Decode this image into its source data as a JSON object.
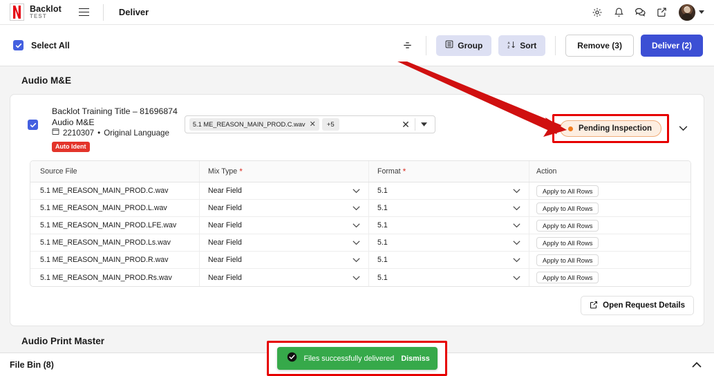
{
  "topbar": {
    "brand_name": "Backlot",
    "brand_sub": "TEST",
    "page_title": "Deliver",
    "icons": [
      "gear-icon",
      "bell-icon",
      "chat-icon",
      "external-link-icon"
    ]
  },
  "actionbar": {
    "select_all_label": "Select All",
    "density_icon": "density-icon",
    "group_label": "Group",
    "sort_label": "Sort",
    "remove_label": "Remove (3)",
    "deliver_label": "Deliver (2)",
    "primary_color": "#3c4fd4",
    "tonal_color": "#dde0f3"
  },
  "sections": {
    "audio_me_title": "Audio M&E",
    "audio_print_master_title": "Audio Print Master"
  },
  "card": {
    "title": "Backlot Training Title – 81696874",
    "subtitle": "Audio M&E",
    "id": "2210307",
    "separator": "•",
    "language": "Original Language",
    "badge": "Auto Ident",
    "badge_color": "#e3342a",
    "file_chip": "5.1 ME_REASON_MAIN_PROD.C.wav",
    "file_chip_more": "+5",
    "status": "Pending Inspection",
    "status_dot_color": "#f07c1e",
    "open_request_label": "Open Request Details"
  },
  "table": {
    "headers": [
      {
        "label": "Source File",
        "required": false
      },
      {
        "label": "Mix Type",
        "required": true
      },
      {
        "label": "Format",
        "required": true
      },
      {
        "label": "Action",
        "required": false
      }
    ],
    "action_label": "Apply to All Rows",
    "rows": [
      {
        "source": "5.1 ME_REASON_MAIN_PROD.C.wav",
        "mix": "Near Field",
        "format": "5.1"
      },
      {
        "source": "5.1 ME_REASON_MAIN_PROD.L.wav",
        "mix": "Near Field",
        "format": "5.1"
      },
      {
        "source": "5.1 ME_REASON_MAIN_PROD.LFE.wav",
        "mix": "Near Field",
        "format": "5.1"
      },
      {
        "source": "5.1 ME_REASON_MAIN_PROD.Ls.wav",
        "mix": "Near Field",
        "format": "5.1"
      },
      {
        "source": "5.1 ME_REASON_MAIN_PROD.R.wav",
        "mix": "Near Field",
        "format": "5.1"
      },
      {
        "source": "5.1 ME_REASON_MAIN_PROD.Rs.wav",
        "mix": "Near Field",
        "format": "5.1"
      }
    ]
  },
  "bottombar": {
    "file_bin_label": "File Bin (8)"
  },
  "toast": {
    "message": "Files successfully delivered",
    "dismiss_label": "Dismiss",
    "background": "#36a94a"
  },
  "annotations": {
    "highlight_color": "#e60000"
  }
}
